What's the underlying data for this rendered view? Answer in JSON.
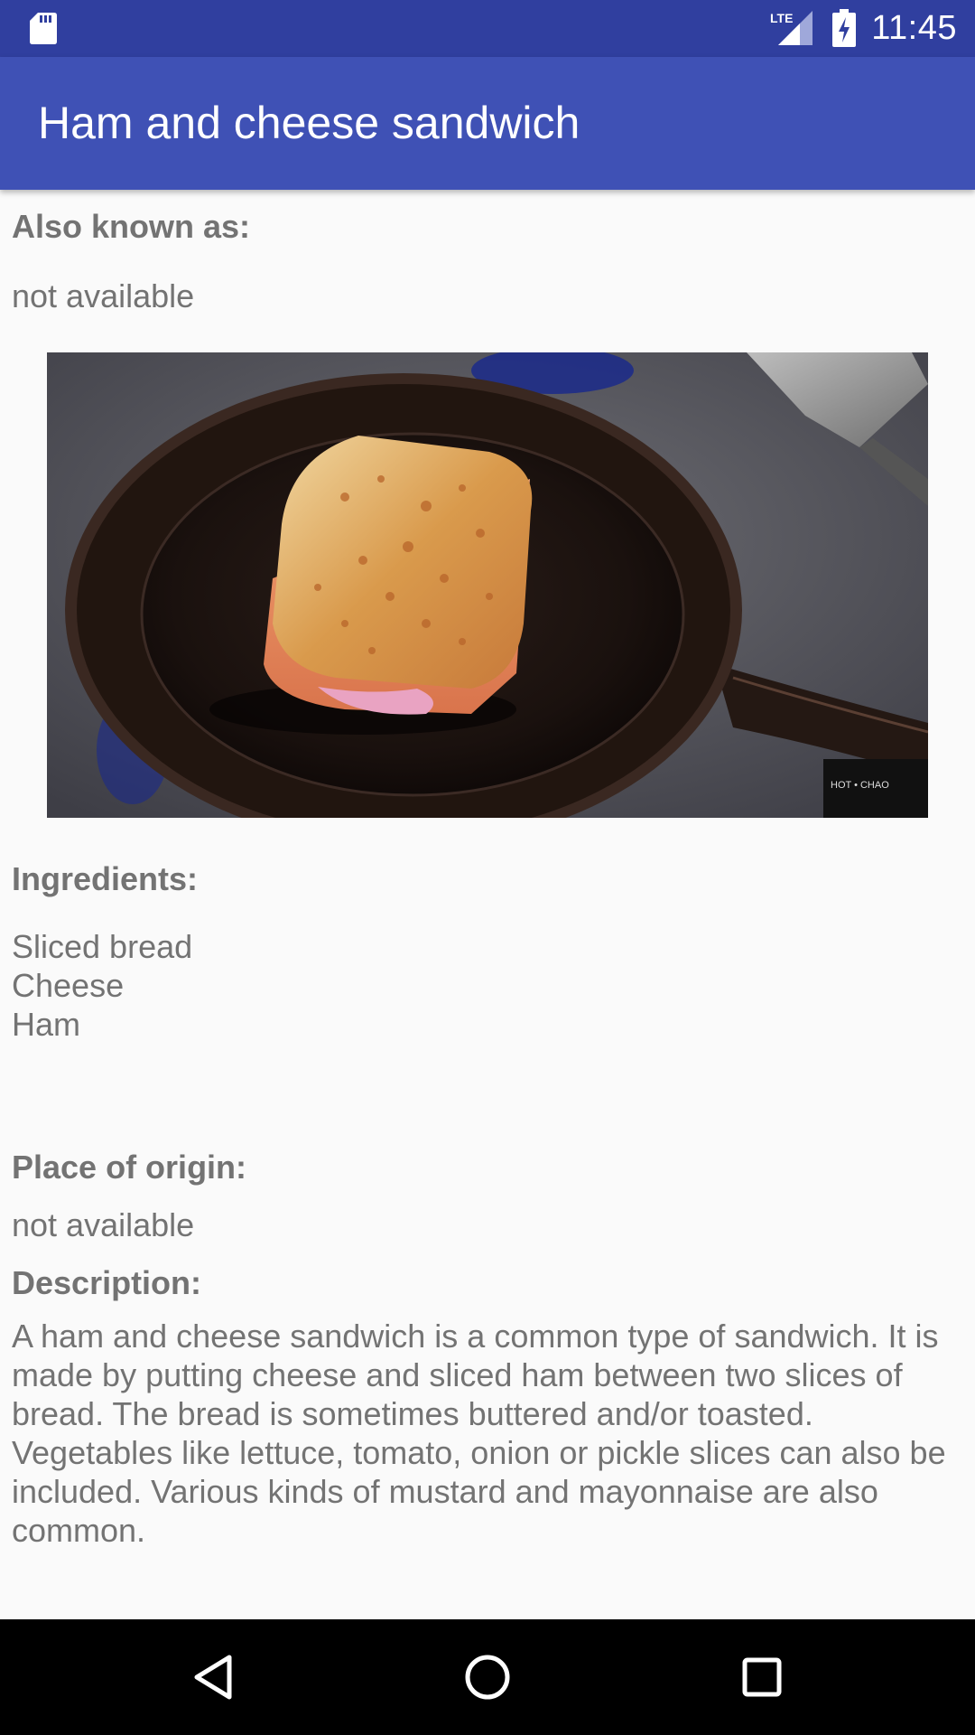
{
  "status_bar": {
    "time": "11:45",
    "network_label": "LTE",
    "icons": [
      "sd-card-icon",
      "lte-signal-icon",
      "battery-charging-icon"
    ]
  },
  "app_bar": {
    "title": "Ham and cheese sandwich"
  },
  "sections": {
    "aka": {
      "label": "Also known as:",
      "value": "not available"
    },
    "ingredients": {
      "label": "Ingredients:",
      "items": [
        "Sliced bread",
        "Cheese",
        "Ham"
      ]
    },
    "origin": {
      "label": "Place of origin:",
      "value": "not available"
    },
    "description": {
      "label": "Description:",
      "text": "A ham and cheese sandwich is a common type of sandwich. It is made by putting cheese and sliced ham between two slices of bread. The bread is sometimes buttered and/or toasted. Vegetables like lettuce, tomato, onion or pickle slices can also be included. Various kinds of mustard and mayonnaise are also common."
    }
  },
  "photo": {
    "stove_knob_text": "HOT • CHAO"
  },
  "nav_bar": {
    "icons": [
      "back-icon",
      "home-icon",
      "recents-icon"
    ]
  },
  "colors": {
    "status_bar": "#303f9f",
    "app_bar": "#3f51b5",
    "text": "#737373",
    "background": "#fafafa",
    "nav_bar": "#000000"
  }
}
